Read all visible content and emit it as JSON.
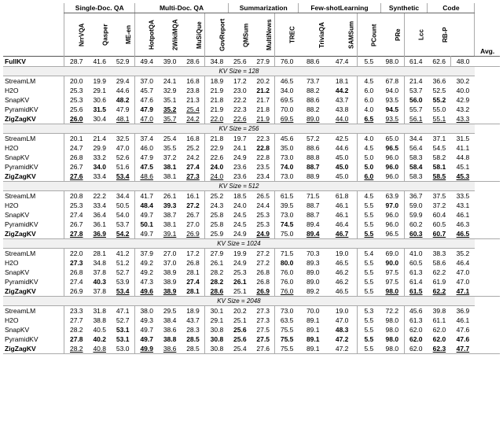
{
  "table": {
    "col_groups": [
      {
        "label": "Single-Doc. QA",
        "span": 3
      },
      {
        "label": "Multi-Doc. QA",
        "span": 4
      },
      {
        "label": "Summarization",
        "span": 3
      },
      {
        "label": "Few-shotLearning",
        "span": 3
      },
      {
        "label": "Synthetic",
        "span": 2
      },
      {
        "label": "Code",
        "span": 2
      },
      {
        "label": "",
        "span": 1
      }
    ],
    "col_headers": [
      "NrrVQA",
      "Qasper",
      "ME-en",
      "HotpotQA",
      "2WikiMQA",
      "MuSiQue",
      "GovReport",
      "QMSum",
      "MultiNews",
      "TREC",
      "TriviaQA",
      "SAMSum",
      "PCount",
      "PRe",
      "Lcc",
      "RB-P",
      "Avg."
    ],
    "fullkv": {
      "label": "FullKV",
      "values": [
        "28.7",
        "41.6",
        "52.9",
        "49.4",
        "39.0",
        "28.6",
        "34.8",
        "25.6",
        "27.9",
        "76.0",
        "88.6",
        "47.4",
        "5.5",
        "98.0",
        "61.4",
        "62.6",
        "48.0"
      ]
    },
    "sections": [
      {
        "kv_label": "KV Size = 128",
        "rows": [
          {
            "label": "StreamLM",
            "values": [
              "20.0",
              "19.9",
              "29.4",
              "37.0",
              "24.1",
              "16.8",
              "18.9",
              "17.2",
              "20.2",
              "46.5",
              "73.7",
              "18.1",
              "4.5",
              "67.8",
              "21.4",
              "36.6",
              "30.2"
            ],
            "bold_indices": []
          },
          {
            "label": "H2O",
            "values": [
              "25.3",
              "29.1",
              "44.6",
              "45.7",
              "32.9",
              "23.8",
              "21.9",
              "23.0",
              "21.2",
              "34.0",
              "88.2",
              "44.2",
              "6.0",
              "94.0",
              "53.7",
              "52.5",
              "40.0"
            ],
            "bold_indices": [
              5,
              8,
              11
            ]
          },
          {
            "label": "SnapKV",
            "values": [
              "25.3",
              "30.6",
              "48.2",
              "47.6",
              "35.1",
              "21.3",
              "21.8",
              "22.2",
              "21.7",
              "69.5",
              "88.6",
              "43.7",
              "6.0",
              "93.5",
              "56.0",
              "55.2",
              "42.9"
            ],
            "bold_indices": [
              2,
              14,
              15
            ]
          },
          {
            "label": "PyramidKV",
            "values": [
              "25.6",
              "31.5",
              "47.9",
              "47.9",
              "35.2",
              "25.4",
              "21.9",
              "22.3",
              "21.8",
              "70.0",
              "88.2",
              "43.8",
              "4.0",
              "94.5",
              "55.7",
              "55.0",
              "43.2"
            ],
            "bold_indices": [
              1,
              3,
              4,
              5,
              13
            ]
          },
          {
            "label": "ZigZagKV",
            "values": [
              "26.0",
              "30.4",
              "48.1",
              "47.0",
              "35.7",
              "24.2",
              "22.0",
              "22.6",
              "21.9",
              "69.5",
              "89.0",
              "44.0",
              "6.5",
              "93.5",
              "56.1",
              "55.1",
              "43.3"
            ],
            "bold_indices": [
              0,
              12,
              14
            ],
            "ul_indices": [
              2,
              3,
              4,
              5,
              6,
              7,
              8,
              9,
              10,
              11,
              12,
              13,
              14,
              15,
              16
            ]
          }
        ]
      },
      {
        "kv_label": "KV Size = 256",
        "rows": [
          {
            "label": "StreamLM",
            "values": [
              "20.1",
              "21.4",
              "32.5",
              "37.4",
              "25.4",
              "16.8",
              "21.8",
              "19.7",
              "22.3",
              "45.6",
              "57.2",
              "42.5",
              "4.0",
              "65.0",
              "34.4",
              "37.1",
              "31.5"
            ],
            "bold_indices": []
          },
          {
            "label": "H2O",
            "values": [
              "24.7",
              "29.9",
              "47.0",
              "46.0",
              "35.5",
              "25.2",
              "22.9",
              "24.1",
              "22.8",
              "35.0",
              "88.6",
              "44.6",
              "4.5",
              "96.5",
              "56.4",
              "54.5",
              "41.1"
            ],
            "bold_indices": [
              8,
              13
            ]
          },
          {
            "label": "SnapKV",
            "values": [
              "26.8",
              "33.2",
              "52.6",
              "47.9",
              "37.2",
              "24.2",
              "22.6",
              "24.9",
              "22.8",
              "73.0",
              "88.8",
              "45.0",
              "5.0",
              "96.0",
              "58.3",
              "58.2",
              "44.8"
            ],
            "bold_indices": []
          },
          {
            "label": "PyramidKV",
            "values": [
              "26.7",
              "34.0",
              "51.6",
              "47.5",
              "38.1",
              "27.4",
              "24.0",
              "23.6",
              "23.5",
              "74.0",
              "88.7",
              "45.0",
              "5.0",
              "96.0",
              "58.4",
              "58.1",
              "45.1"
            ],
            "bold_indices": [
              1,
              3,
              4,
              5,
              6,
              9,
              10,
              11,
              12,
              13,
              14,
              15
            ]
          },
          {
            "label": "ZigZagKV",
            "values": [
              "27.6",
              "33.4",
              "53.4",
              "48.6",
              "38.1",
              "27.3",
              "24.0",
              "23.6",
              "23.4",
              "73.0",
              "88.9",
              "45.0",
              "6.0",
              "96.0",
              "58.3",
              "58.5",
              "45.3"
            ],
            "bold_indices": [
              0,
              2,
              5,
              12,
              15,
              16
            ]
          }
        ]
      },
      {
        "kv_label": "KV Size = 512",
        "rows": [
          {
            "label": "StreamLM",
            "values": [
              "20.8",
              "22.2",
              "34.4",
              "41.7",
              "26.1",
              "16.1",
              "25.2",
              "18.5",
              "26.5",
              "61.5",
              "71.5",
              "61.8",
              "4.5",
              "63.9",
              "36.7",
              "37.5",
              "33.5"
            ],
            "bold_indices": []
          },
          {
            "label": "H2O",
            "values": [
              "25.3",
              "33.4",
              "50.5",
              "48.4",
              "39.3",
              "27.2",
              "24.3",
              "24.0",
              "24.4",
              "39.5",
              "88.7",
              "46.1",
              "5.5",
              "97.0",
              "59.0",
              "37.2",
              "43.1"
            ],
            "bold_indices": [
              3,
              4,
              5,
              13
            ]
          },
          {
            "label": "SnapKV",
            "values": [
              "27.4",
              "36.4",
              "54.0",
              "49.7",
              "38.7",
              "26.7",
              "25.8",
              "24.5",
              "25.3",
              "73.0",
              "88.7",
              "46.1",
              "5.5",
              "96.0",
              "59.9",
              "60.4",
              "46.1"
            ],
            "bold_indices": []
          },
          {
            "label": "PyramidKV",
            "values": [
              "26.7",
              "36.1",
              "53.7",
              "50.1",
              "38.1",
              "27.0",
              "25.8",
              "24.5",
              "25.3",
              "74.5",
              "89.4",
              "46.4",
              "5.5",
              "96.0",
              "60.2",
              "60.5",
              "46.3"
            ],
            "bold_indices": [
              3,
              9
            ]
          },
          {
            "label": "ZigZagKV",
            "values": [
              "27.8",
              "36.9",
              "54.2",
              "49.7",
              "39.1",
              "26.9",
              "25.9",
              "24.9",
              "24.9",
              "75.0",
              "89.4",
              "46.7",
              "5.5",
              "96.5",
              "60.3",
              "60.7",
              "46.5"
            ],
            "bold_indices": [
              0,
              1,
              2,
              8,
              10,
              11,
              12,
              14,
              15,
              16
            ]
          }
        ]
      },
      {
        "kv_label": "KV Size = 1024",
        "rows": [
          {
            "label": "StreamLM",
            "values": [
              "22.0",
              "28.1",
              "41.2",
              "37.9",
              "27.0",
              "17.2",
              "27.9",
              "19.9",
              "27.2",
              "71.5",
              "70.3",
              "19.0",
              "5.4",
              "69.0",
              "41.0",
              "38.3",
              "35.2"
            ],
            "bold_indices": []
          },
          {
            "label": "H2O",
            "values": [
              "27.3",
              "34.8",
              "51.2",
              "49.2",
              "37.0",
              "26.8",
              "26.1",
              "24.9",
              "27.2",
              "80.0",
              "89.3",
              "46.5",
              "5.5",
              "90.0",
              "60.5",
              "58.6",
              "46.4"
            ],
            "bold_indices": [
              0,
              9,
              13
            ]
          },
          {
            "label": "SnapKV",
            "values": [
              "26.8",
              "37.8",
              "52.7",
              "49.2",
              "38.9",
              "28.1",
              "28.2",
              "25.3",
              "26.8",
              "76.0",
              "89.0",
              "46.2",
              "5.5",
              "97.5",
              "61.3",
              "62.2",
              "47.0"
            ],
            "bold_indices": []
          },
          {
            "label": "PyramidKV",
            "values": [
              "27.4",
              "40.3",
              "53.9",
              "47.3",
              "38.9",
              "27.4",
              "28.2",
              "26.1",
              "26.8",
              "76.0",
              "89.0",
              "46.2",
              "5.5",
              "97.5",
              "61.4",
              "61.9",
              "47.0"
            ],
            "bold_indices": [
              1,
              5,
              6,
              7
            ]
          },
          {
            "label": "ZigZagKV",
            "values": [
              "26.9",
              "37.8",
              "53.4",
              "49.6",
              "38.9",
              "28.1",
              "28.6",
              "25.1",
              "26.9",
              "76.0",
              "89.2",
              "46.5",
              "5.5",
              "98.0",
              "61.5",
              "62.2",
              "47.1"
            ],
            "bold_indices": [
              2,
              3,
              4,
              5,
              6,
              8,
              13,
              14,
              15,
              16
            ]
          }
        ]
      },
      {
        "kv_label": "KV Size = 2048",
        "rows": [
          {
            "label": "StreamLM",
            "values": [
              "23.3",
              "31.8",
              "47.1",
              "38.0",
              "29.5",
              "18.9",
              "30.1",
              "20.2",
              "27.3",
              "73.0",
              "70.0",
              "19.0",
              "5.3",
              "72.2",
              "45.6",
              "39.8",
              "36.9"
            ],
            "bold_indices": []
          },
          {
            "label": "H2O",
            "values": [
              "27.7",
              "38.8",
              "52.7",
              "49.3",
              "38.4",
              "43.7",
              "29.1",
              "25.1",
              "27.3",
              "63.5",
              "89.1",
              "47.0",
              "5.5",
              "98.0",
              "61.3",
              "61.1",
              "46.1"
            ],
            "bold_indices": []
          },
          {
            "label": "SnapKV",
            "values": [
              "28.2",
              "40.5",
              "53.1",
              "49.7",
              "38.6",
              "28.3",
              "30.8",
              "25.6",
              "27.5",
              "75.5",
              "89.1",
              "48.3",
              "5.5",
              "98.0",
              "62.0",
              "62.0",
              "47.6"
            ],
            "bold_indices": [
              2,
              7,
              11
            ]
          },
          {
            "label": "PyramidKV",
            "values": [
              "27.8",
              "40.2",
              "53.1",
              "49.7",
              "38.8",
              "28.5",
              "30.8",
              "25.6",
              "27.5",
              "75.5",
              "89.1",
              "47.2",
              "5.5",
              "98.0",
              "62.0",
              "62.0",
              "47.6"
            ],
            "bold_indices": [
              0,
              1,
              2,
              3,
              4,
              5,
              6,
              7,
              8,
              9,
              10,
              11,
              12,
              13,
              14,
              15,
              16
            ]
          },
          {
            "label": "ZigZagKV",
            "values": [
              "28.2",
              "40.8",
              "53.0",
              "49.9",
              "38.6",
              "28.5",
              "30.8",
              "25.4",
              "27.6",
              "75.5",
              "89.1",
              "47.2",
              "5.5",
              "98.0",
              "62.0",
              "62.3",
              "47.7"
            ],
            "bold_indices": [
              3,
              15,
              16
            ]
          }
        ]
      }
    ]
  }
}
